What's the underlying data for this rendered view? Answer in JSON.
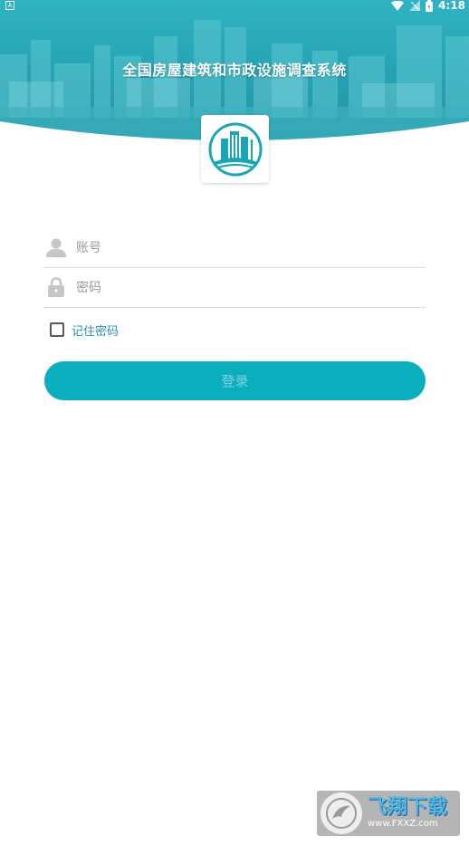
{
  "status_bar": {
    "left_indicator": "A",
    "time": "4:18"
  },
  "header": {
    "title": "全国房屋建筑和市政设施调查系统"
  },
  "logo": {
    "icon": "building-logo-icon"
  },
  "form": {
    "account_placeholder": "账号",
    "account_value": "",
    "password_placeholder": "密码",
    "password_value": "",
    "remember_label": "记住密码",
    "remember_checked": false,
    "login_label": "登录"
  },
  "watermark": {
    "brand": "飞翔下载",
    "site": "www.FXXZ.com"
  },
  "colors": {
    "accent": "#0aaebd",
    "link": "#2a8fb0",
    "banner": "#2a9fb0"
  }
}
